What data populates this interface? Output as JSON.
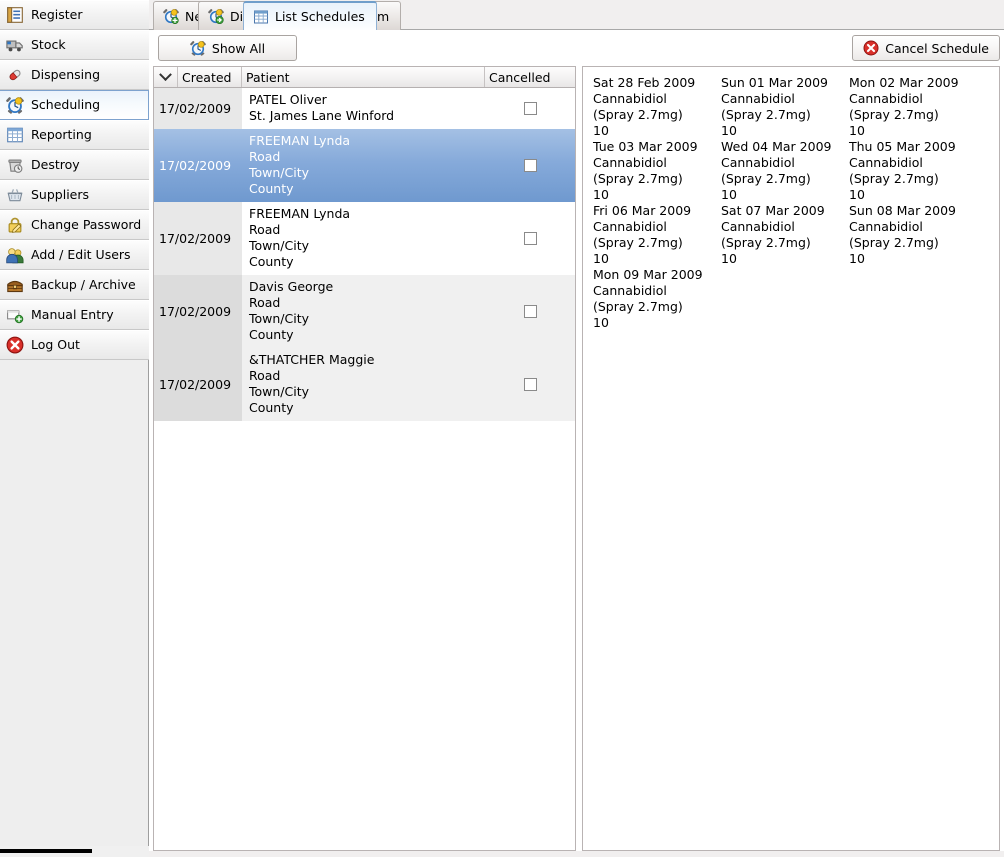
{
  "sidebar": {
    "items": [
      {
        "label": "Register",
        "icon": "register-book-icon",
        "selected": false
      },
      {
        "label": "Stock",
        "icon": "truck-icon",
        "selected": false
      },
      {
        "label": "Dispensing",
        "icon": "pill-capsule-icon",
        "selected": false
      },
      {
        "label": "Scheduling",
        "icon": "alarm-clock-icon",
        "selected": true
      },
      {
        "label": "Reporting",
        "icon": "report-table-icon",
        "selected": false
      },
      {
        "label": "Destroy",
        "icon": "destroy-bin-icon",
        "selected": false
      },
      {
        "label": "Suppliers",
        "icon": "basket-icon",
        "selected": false
      },
      {
        "label": "Change Password",
        "icon": "padlock-edit-icon",
        "selected": false
      },
      {
        "label": "Add / Edit Users",
        "icon": "users-icon",
        "selected": false
      },
      {
        "label": "Backup / Archive",
        "icon": "archive-chest-icon",
        "selected": false
      },
      {
        "label": "Manual Entry",
        "icon": "manual-entry-add-icon",
        "selected": false
      },
      {
        "label": "Log Out",
        "icon": "logout-cross-icon",
        "selected": false
      }
    ]
  },
  "tabs": [
    {
      "label": "New Schedule",
      "icon": "clock-add-icon",
      "active": false
    },
    {
      "label": "Dispense Scheduled Item",
      "icon": "clock-go-icon",
      "active": false
    },
    {
      "label": "List Schedules",
      "icon": "list-table-icon",
      "active": true
    }
  ],
  "toolbar": {
    "show_all_label": "Show All",
    "show_all_icon": "alarm-clock-icon",
    "cancel_schedule_label": "Cancel Schedule",
    "cancel_schedule_icon": "cancel-cross-icon"
  },
  "schedule_table": {
    "columns": {
      "sort_indicator": "chevron-down-icon",
      "created": "Created",
      "patient": "Patient",
      "cancelled": "Cancelled"
    },
    "rows": [
      {
        "created": "17/02/2009",
        "patient_lines": [
          "PATEL Oliver",
          "St. James Lane Winford"
        ],
        "cancelled": false,
        "selected": false,
        "alt": false
      },
      {
        "created": "17/02/2009",
        "patient_lines": [
          "FREEMAN Lynda",
          "Road",
          "Town/City",
          "County"
        ],
        "cancelled": false,
        "selected": true,
        "alt": false
      },
      {
        "created": "17/02/2009",
        "patient_lines": [
          "FREEMAN Lynda",
          "Road",
          "Town/City",
          "County"
        ],
        "cancelled": false,
        "selected": false,
        "alt": false
      },
      {
        "created": "17/02/2009",
        "patient_lines": [
          "Davis George",
          "Road",
          "Town/City",
          "County"
        ],
        "cancelled": false,
        "selected": false,
        "alt": true
      },
      {
        "created": "17/02/2009",
        "patient_lines": [
          "&THATCHER Maggie",
          "Road",
          "Town/City",
          "County"
        ],
        "cancelled": false,
        "selected": false,
        "alt": true
      }
    ]
  },
  "schedule_dates": [
    {
      "date": "Sat 28 Feb 2009",
      "drug": "Cannabidiol",
      "form": "(Spray 2.7mg)",
      "qty": "10"
    },
    {
      "date": "Sun 01 Mar 2009",
      "drug": "Cannabidiol",
      "form": "(Spray 2.7mg)",
      "qty": "10"
    },
    {
      "date": "Mon 02 Mar 2009",
      "drug": "Cannabidiol",
      "form": "(Spray 2.7mg)",
      "qty": "10"
    },
    {
      "date": "Tue 03 Mar 2009",
      "drug": "Cannabidiol",
      "form": "(Spray 2.7mg)",
      "qty": "10"
    },
    {
      "date": "Wed 04 Mar 2009",
      "drug": "Cannabidiol",
      "form": "(Spray 2.7mg)",
      "qty": "10"
    },
    {
      "date": "Thu 05 Mar 2009",
      "drug": "Cannabidiol",
      "form": "(Spray 2.7mg)",
      "qty": "10"
    },
    {
      "date": "Fri 06 Mar 2009",
      "drug": "Cannabidiol",
      "form": "(Spray 2.7mg)",
      "qty": "10"
    },
    {
      "date": "Sat 07 Mar 2009",
      "drug": "Cannabidiol",
      "form": "(Spray 2.7mg)",
      "qty": "10"
    },
    {
      "date": "Sun 08 Mar 2009",
      "drug": "Cannabidiol",
      "form": "(Spray 2.7mg)",
      "qty": "10"
    },
    {
      "date": "Mon 09 Mar 2009",
      "drug": "Cannabidiol",
      "form": "(Spray 2.7mg)",
      "qty": "10"
    }
  ],
  "colors": {
    "selection_blue": "#6f99cf",
    "active_tab_blue": "#6f9ecb",
    "sidebar_bg": "#eeeeee",
    "alt_row": "#f0f0f0",
    "date_col_bg": "#e8e8e8"
  }
}
